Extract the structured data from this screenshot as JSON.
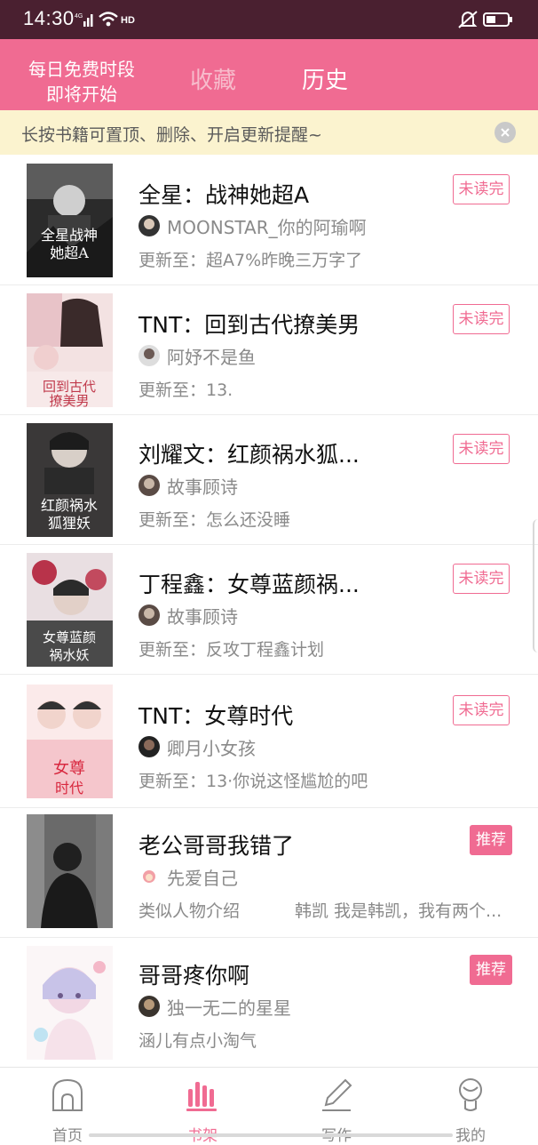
{
  "status_bar": {
    "time": "14:30",
    "network": "4G",
    "hd_label": "HD"
  },
  "header": {
    "promo_line1": "每日免费时段",
    "promo_line2": "即将开始",
    "tabs": [
      {
        "label": "收藏",
        "active": false
      },
      {
        "label": "历史",
        "active": true
      }
    ]
  },
  "notice": {
    "text": "长按书籍可置顶、删除、开启更新提醒~"
  },
  "books": [
    {
      "title": "全星：战神她超A",
      "author": "MOONSTAR_你的阿瑜啊",
      "update": "更新至：超A7%昨晚三万字了",
      "badge": "未读完",
      "cover_text": "全星战神她超A"
    },
    {
      "title": "TNT：回到古代撩美男",
      "author": "阿妤不是鱼",
      "update": "更新至：13.",
      "badge": "未读完",
      "cover_text": "回到古代撩美男"
    },
    {
      "title": "刘耀文：红颜祸水狐...",
      "author": "故事顾诗",
      "update": "更新至：怎么还没睡",
      "badge": "未读完",
      "cover_text": "红颜祸水狐狸妖"
    },
    {
      "title": "丁程鑫：女尊蓝颜祸...",
      "author": "故事顾诗",
      "update": "更新至：反攻丁程鑫计划",
      "badge": "未读完",
      "cover_text": "女尊蓝颜祸水妖"
    },
    {
      "title": "TNT：女尊时代",
      "author": "卿月小女孩",
      "update": "更新至：13·你说这怪尴尬的吧",
      "badge": "未读完",
      "cover_text": "女尊时代"
    },
    {
      "title": "老公哥哥我错了",
      "author": "先爱自己",
      "update": "类似人物介绍",
      "update_extra": "韩凯 我是韩凯，我有两个...",
      "badge": "推荐",
      "cover_text": ""
    },
    {
      "title": "哥哥疼你啊",
      "author": "独一无二的星星",
      "update": "涵儿有点小淘气",
      "badge": "推荐",
      "cover_text": ""
    }
  ],
  "nav": [
    {
      "label": "首页",
      "icon": "home-icon",
      "active": false
    },
    {
      "label": "书架",
      "icon": "bookshelf-icon",
      "active": true
    },
    {
      "label": "写作",
      "icon": "pen-icon",
      "active": false
    },
    {
      "label": "我的",
      "icon": "profile-icon",
      "active": false
    }
  ],
  "colors": {
    "accent": "#f06b92",
    "status_bar": "#4a2030",
    "notice_bg": "#fbf3cf"
  }
}
